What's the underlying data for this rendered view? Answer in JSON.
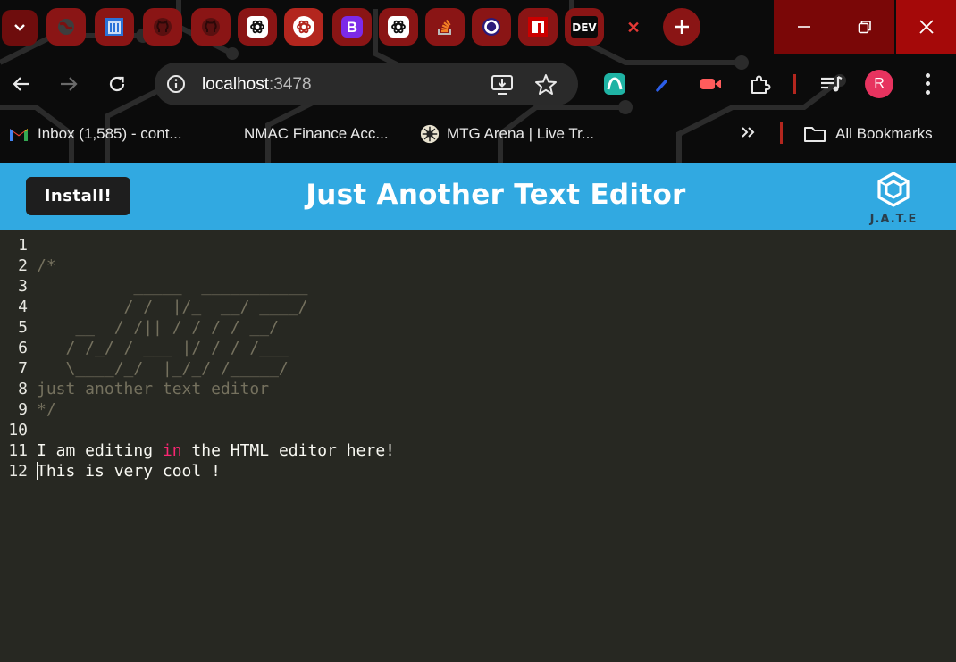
{
  "browser": {
    "tabs": [
      {
        "icon": "globe-icon"
      },
      {
        "icon": "library-building-icon"
      },
      {
        "icon": "github-icon"
      },
      {
        "icon": "github-icon"
      },
      {
        "icon": "openai-icon"
      },
      {
        "icon": "openai-icon"
      },
      {
        "icon": "bootstrap-icon",
        "text": "B"
      },
      {
        "icon": "openai-icon"
      },
      {
        "icon": "stackoverflow-icon"
      },
      {
        "icon": "purple-ring-icon"
      },
      {
        "icon": "npm-icon"
      },
      {
        "icon": "dev-icon",
        "text": "DEV"
      }
    ],
    "new_tab_icon": "plus-icon",
    "window_controls": [
      "minimize-icon",
      "restore-icon",
      "close-icon"
    ],
    "address": {
      "host": "localhost",
      "port": ":3478"
    },
    "bookmarks": [
      {
        "label": "Inbox (1,585) - cont...",
        "icon": "gmail-icon"
      },
      {
        "label": "NMAC Finance Acc...",
        "icon": "blank"
      },
      {
        "label": "MTG Arena | Live Tr...",
        "icon": "mtg-icon"
      }
    ],
    "all_bookmarks": "All Bookmarks",
    "profile_initial": "R",
    "colors": {
      "frame": "#0b0b0b",
      "tab": "#8a1515",
      "window_close": "#a50909",
      "avatar": "#e7335f"
    }
  },
  "app": {
    "install_label": "Install!",
    "title": "Just Another Text Editor",
    "logo_caption": "J.A.T.E",
    "colors": {
      "header": "#31a9e1",
      "editor_bg": "#272822",
      "comment": "#75715e",
      "keyword": "#f92672",
      "text": "#f8f8f2"
    }
  },
  "editor": {
    "line_numbers": [
      "1",
      "2",
      "3",
      "4",
      "5",
      "6",
      "7",
      "8",
      "9",
      "10",
      "11",
      "12"
    ],
    "lines": {
      "l2": "/*",
      "l3": "          _____  ___________",
      "l4": "         / /  |/_  __/ ____/",
      "l5": "    __  / /|| / / / / __/",
      "l6": "   / /_/ / ___ |/ / / /___",
      "l7": "   \\____/_/  |_/_/ /_____/",
      "l8": "just another text editor",
      "l9": "*/",
      "l11_before": "I am editing ",
      "l11_keyword": "in",
      "l11_after": " the HTML editor here!",
      "l12": "This is very cool !"
    }
  }
}
